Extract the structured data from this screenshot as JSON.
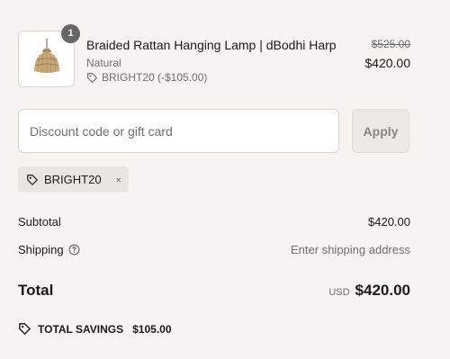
{
  "product": {
    "quantity": "1",
    "title": "Braided Rattan Hanging Lamp | dBodhi Harp",
    "variant": "Natural",
    "discount": "BRIGHT20 (-$105.00)",
    "original_price": "$525.00",
    "price": "$420.00",
    "image_icon": "rattan-lamp-image"
  },
  "discount_form": {
    "placeholder": "Discount code or gift card",
    "apply_label": "Apply"
  },
  "applied_code": {
    "code": "BRIGHT20",
    "tag_icon": "tag-icon",
    "remove_icon": "close-icon"
  },
  "summary": {
    "subtotal_label": "Subtotal",
    "subtotal_value": "$420.00",
    "shipping_label": "Shipping",
    "shipping_value": "Enter shipping address",
    "total_label": "Total",
    "currency": "USD",
    "total_value": "$420.00",
    "savings_label": "TOTAL SAVINGS",
    "savings_value": "$105.00"
  },
  "colors": {
    "background": "#f6f3f0",
    "text": "#1a1a1a",
    "muted": "#707070",
    "badge": "#666666"
  }
}
